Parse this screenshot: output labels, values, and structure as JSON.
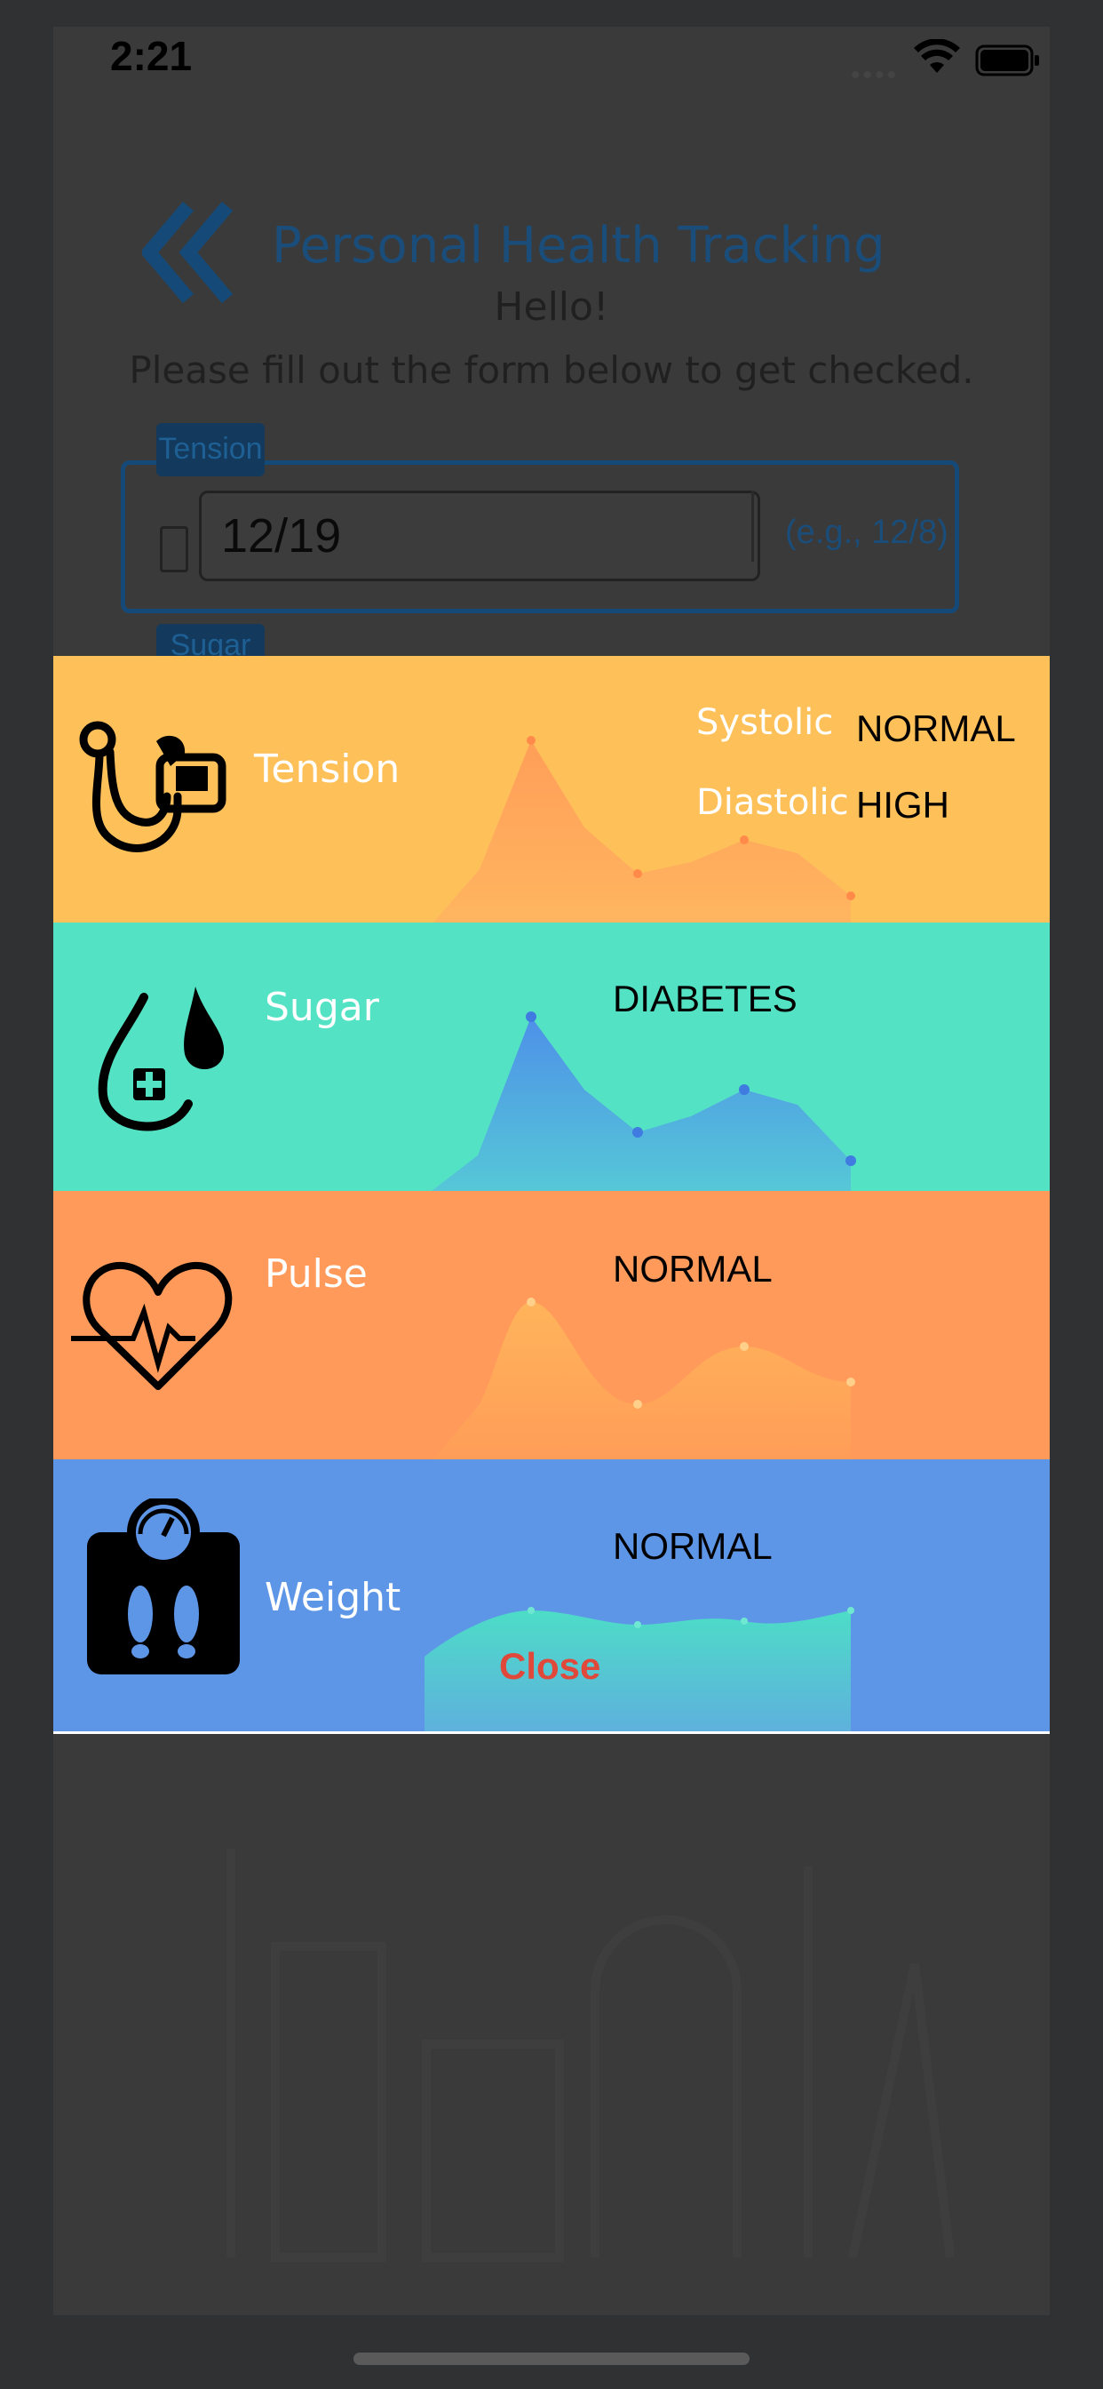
{
  "status_bar": {
    "time": "2:21"
  },
  "background_form": {
    "title": "Personal Health Tracking",
    "greeting": "Hello!",
    "instructions": "Please fill out the form below to get checked.",
    "tension_tag": "Tension",
    "tension_value": "12/19",
    "tension_hint": "(e.g., 12/8)",
    "sugar_tag": "Sugar"
  },
  "results": {
    "tension": {
      "label": "Tension",
      "systolic_label": "Systolic",
      "systolic_status": "NORMAL",
      "diastolic_label": "Diastolic",
      "diastolic_status": "HIGH",
      "color": "#fec15a"
    },
    "sugar": {
      "label": "Sugar",
      "status": "DIABETES",
      "color": "#53e3c4"
    },
    "pulse": {
      "label": "Pulse",
      "status": "NORMAL",
      "color": "#ff9a5a"
    },
    "weight": {
      "label": "Weight",
      "status": "NORMAL",
      "color": "#5e96e7"
    }
  },
  "close_label": "Close",
  "icons": [
    "chevron-left-double-icon",
    "blood-pressure-icon",
    "blood-drop-icon",
    "heart-pulse-icon",
    "scale-icon",
    "wifi-icon",
    "battery-icon"
  ]
}
